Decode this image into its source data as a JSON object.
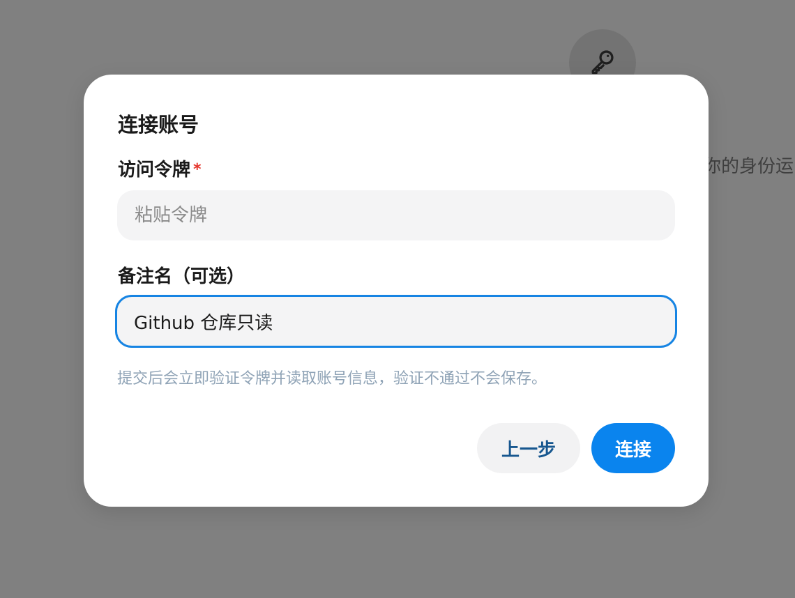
{
  "background": {
    "avatar_icon": "key-icon",
    "partial_text": "你的身份运"
  },
  "dialog": {
    "title": "连接账号",
    "token_field": {
      "label": "访问令牌",
      "required_mark": "*",
      "placeholder": "粘贴令牌",
      "value": ""
    },
    "note_field": {
      "label": "备注名（可选）",
      "placeholder": "",
      "value": "Github 仓库只读"
    },
    "hint": "提交后会立即验证令牌并读取账号信息，验证不通过不会保存。",
    "buttons": {
      "back_label": "上一步",
      "connect_label": "连接"
    }
  },
  "colors": {
    "backdrop": "#808080",
    "accent": "#0a84ee",
    "focus_border": "#1684e3",
    "required": "#e5332a",
    "hint_text": "#8fa3b6"
  }
}
